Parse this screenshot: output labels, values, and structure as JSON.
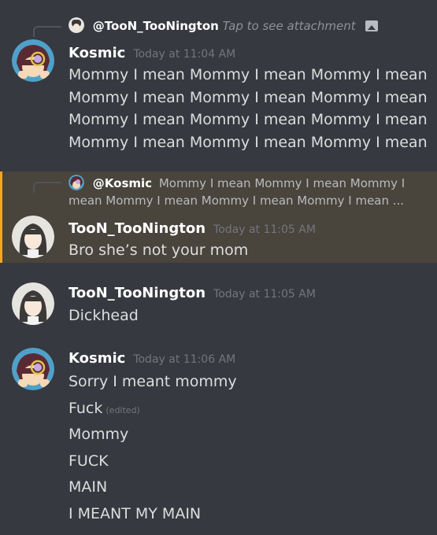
{
  "messages": [
    {
      "reply": {
        "username": "@TooN_TooNington",
        "hint": "Tap to see attachment",
        "icon": "image-icon"
      },
      "author": "Kosmic",
      "timestamp": "Today at 11:04 AM",
      "lines": [
        "Mommy I mean Mommy I mean Mommy I mean",
        "Mommy I mean Mommy I mean Mommy I mean",
        "Mommy I mean Mommy I mean Mommy I mean",
        "Mommy I mean Mommy I mean Mommy I mean"
      ]
    },
    {
      "reply": {
        "username": "@Kosmic",
        "line1": "Mommy I mean Mommy I mean Mommy I",
        "line2": "mean Mommy I mean Mommy I mean Mommy I mean ..."
      },
      "author": "TooN_TooNington",
      "timestamp": "Today at 11:05 AM",
      "lines": [
        "Bro she’s not your mom"
      ]
    },
    {
      "author": "TooN_TooNington",
      "timestamp": "Today at 11:05 AM",
      "lines": [
        "Dickhead"
      ]
    },
    {
      "author": "Kosmic",
      "timestamp": "Today at 11:06 AM",
      "lines": [
        "Sorry I meant mommy",
        "Fuck",
        "Mommy",
        "FUCK",
        "MAIN",
        "I MEANT MY MAIN"
      ],
      "edited_label": "(edited)"
    }
  ],
  "colors": {
    "background": "#36393f",
    "highlight": "#49443c",
    "mention_bar": "#faa61a"
  }
}
